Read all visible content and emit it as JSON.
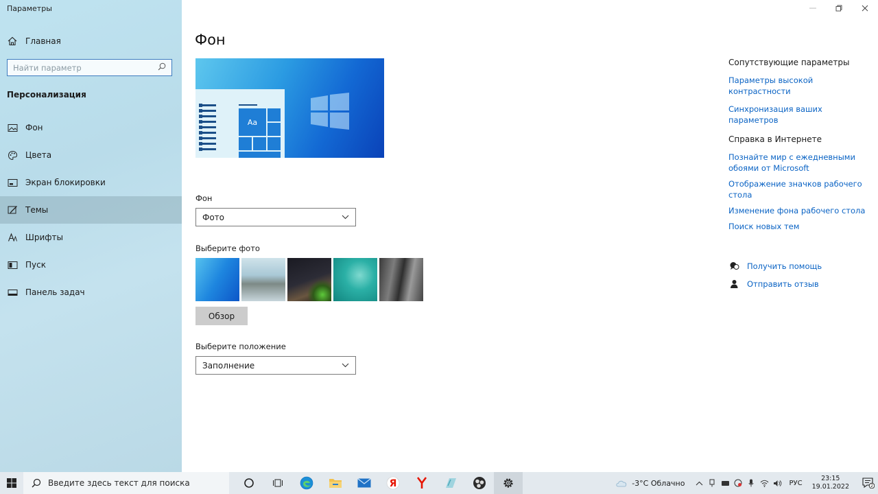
{
  "window": {
    "title": "Параметры"
  },
  "sidebar": {
    "home_label": "Главная",
    "search_placeholder": "Найти параметр",
    "section_title": "Персонализация",
    "items": [
      {
        "label": "Фон",
        "icon": "image-icon"
      },
      {
        "label": "Цвета",
        "icon": "palette-icon"
      },
      {
        "label": "Экран блокировки",
        "icon": "lock-screen-icon"
      },
      {
        "label": "Темы",
        "icon": "brush-icon"
      },
      {
        "label": "Шрифты",
        "icon": "font-icon"
      },
      {
        "label": "Пуск",
        "icon": "start-icon"
      },
      {
        "label": "Панель задач",
        "icon": "taskbar-icon"
      }
    ]
  },
  "main": {
    "title": "Фон",
    "preview": {
      "tile_text": "Aa"
    },
    "background": {
      "label": "Фон",
      "value": "Фото"
    },
    "choose_photo_label": "Выберите фото",
    "browse_label": "Обзор",
    "position": {
      "label": "Выберите положение",
      "value": "Заполнение"
    }
  },
  "related": {
    "title": "Сопутствующие параметры",
    "links": [
      "Параметры высокой контрастности",
      "Синхронизация ваших параметров"
    ]
  },
  "web_help": {
    "title": "Справка в Интернете",
    "links": [
      "Познайте мир с ежедневными обоями от Microsoft",
      "Отображение значков рабочего стола",
      "Изменение фона рабочего стола",
      "Поиск новых тем"
    ]
  },
  "help": {
    "get_help": "Получить помощь",
    "feedback": "Отправить отзыв"
  },
  "taskbar": {
    "search_placeholder": "Введите здесь текст для поиска",
    "weather": "-3°C Облачно",
    "lang": "РУС",
    "time": "23:15",
    "date": "19.01.2022",
    "notif_count": "2"
  },
  "colors": {
    "accent": "#0a63c4",
    "sidebar_bg": "#bfe3f0",
    "taskbar_bg": "#e3e9ee"
  }
}
